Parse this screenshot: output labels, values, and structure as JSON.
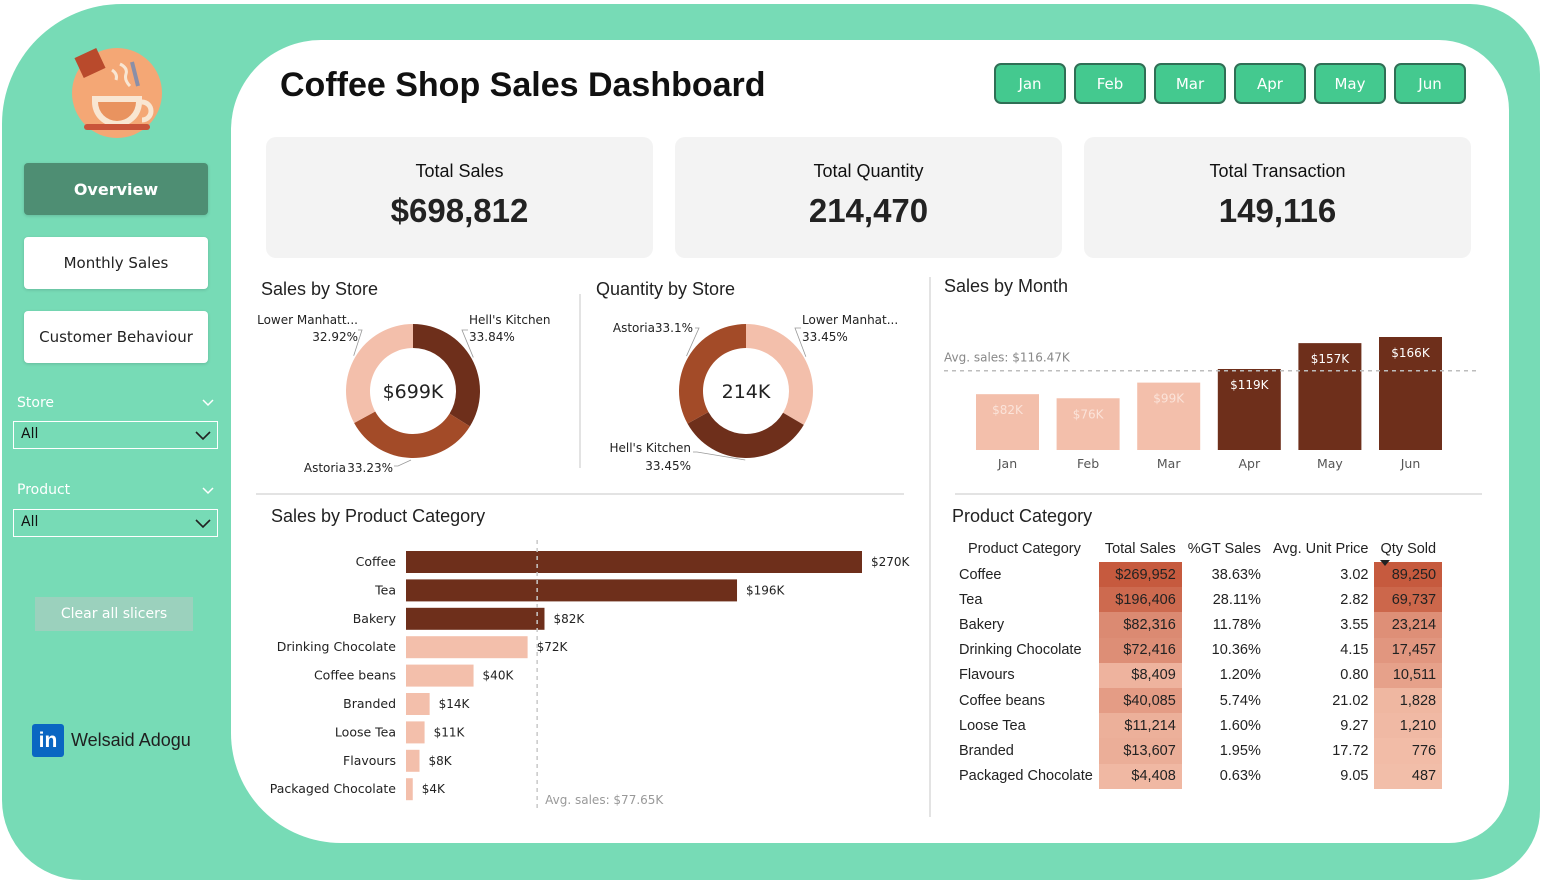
{
  "sidebar": {
    "nav": [
      "Overview",
      "Monthly Sales",
      "Customer Behaviour"
    ],
    "store_label": "Store",
    "store_value": "All",
    "product_label": "Product",
    "product_value": "All",
    "clear_label": "Clear all slicers",
    "author": "Welsaid Adogu",
    "author_icon": "linkedin-icon",
    "logo_icon": "coffee-cup-icon"
  },
  "header": {
    "title": "Coffee Shop Sales Dashboard",
    "months": [
      "Jan",
      "Feb",
      "Mar",
      "Apr",
      "May",
      "Jun"
    ]
  },
  "kpis": [
    {
      "label": "Total Sales",
      "value": "$698,812"
    },
    {
      "label": "Total Quantity",
      "value": "214,470"
    },
    {
      "label": "Total Transaction",
      "value": "149,116"
    }
  ],
  "colors": {
    "frame": "#77dbb6",
    "dark": "#6e2f1b",
    "mid": "#a34b28",
    "light": "#f3bfab",
    "month_button": "#44c98f"
  },
  "chart_data": [
    {
      "type": "pie",
      "title": "Sales by Store",
      "center_label": "$699K",
      "slices": [
        {
          "label": "Hell's Kitchen",
          "value": 33.84,
          "text": "33.84%"
        },
        {
          "label": "Astoria",
          "value": 33.23,
          "text": "33.23%"
        },
        {
          "label": "Lower Manhatt...",
          "value": 32.92,
          "text": "32.92%"
        }
      ]
    },
    {
      "type": "pie",
      "title": "Quantity by Store",
      "center_label": "214K",
      "slices": [
        {
          "label": "Lower Manhat...",
          "value": 33.45,
          "text": "33.45%"
        },
        {
          "label": "Hell's Kitchen",
          "value": 33.45,
          "text": "33.45%"
        },
        {
          "label": "Astoria",
          "value": 33.1,
          "text": "33.1%"
        }
      ]
    },
    {
      "type": "bar",
      "title": "Sales by Month",
      "categories": [
        "Jan",
        "Feb",
        "Mar",
        "Apr",
        "May",
        "Jun"
      ],
      "values": [
        82,
        76,
        99,
        119,
        157,
        166
      ],
      "labels": [
        "$82K",
        "$76K",
        "$99K",
        "$119K",
        "$157K",
        "$166K"
      ],
      "highlight": [
        false,
        false,
        false,
        true,
        true,
        true
      ],
      "average": 116.47,
      "average_label": "Avg. sales: $116.47K",
      "ylim": [
        0,
        166
      ]
    },
    {
      "type": "bar",
      "orientation": "horizontal",
      "title": "Sales by Product Category",
      "categories": [
        "Coffee",
        "Tea",
        "Bakery",
        "Drinking Chocolate",
        "Coffee beans",
        "Branded",
        "Loose Tea",
        "Flavours",
        "Packaged Chocolate"
      ],
      "values": [
        270,
        196,
        82,
        72,
        40,
        14,
        11,
        8,
        4
      ],
      "labels": [
        "$270K",
        "$196K",
        "$82K",
        "$72K",
        "$40K",
        "$14K",
        "$11K",
        "$8K",
        "$4K"
      ],
      "highlight": [
        true,
        true,
        true,
        false,
        false,
        false,
        false,
        false,
        false
      ],
      "average": 77.65,
      "average_label": "Avg. sales: $77.65K",
      "xlim": [
        0,
        270
      ]
    },
    {
      "type": "table",
      "title": "Product Category",
      "columns": [
        "Product Category",
        "Total Sales",
        "%GT Sales",
        "Avg. Unit Price",
        "Qty Sold"
      ],
      "rows": [
        {
          "category": "Coffee",
          "sales": "$269,952",
          "pct": "38.63%",
          "price": "3.02",
          "qty": "89,250",
          "sales_num": 269952,
          "qty_num": 89250
        },
        {
          "category": "Tea",
          "sales": "$196,406",
          "pct": "28.11%",
          "price": "2.82",
          "qty": "69,737",
          "sales_num": 196406,
          "qty_num": 69737
        },
        {
          "category": "Bakery",
          "sales": "$82,316",
          "pct": "11.78%",
          "price": "3.55",
          "qty": "23,214",
          "sales_num": 82316,
          "qty_num": 23214
        },
        {
          "category": "Drinking Chocolate",
          "sales": "$72,416",
          "pct": "10.36%",
          "price": "4.15",
          "qty": "17,457",
          "sales_num": 72416,
          "qty_num": 17457
        },
        {
          "category": "Flavours",
          "sales": "$8,409",
          "pct": "1.20%",
          "price": "0.80",
          "qty": "10,511",
          "sales_num": 8409,
          "qty_num": 10511
        },
        {
          "category": "Coffee beans",
          "sales": "$40,085",
          "pct": "5.74%",
          "price": "21.02",
          "qty": "1,828",
          "sales_num": 40085,
          "qty_num": 1828
        },
        {
          "category": "Loose Tea",
          "sales": "$11,214",
          "pct": "1.60%",
          "price": "9.27",
          "qty": "1,210",
          "sales_num": 11214,
          "qty_num": 1210
        },
        {
          "category": "Branded",
          "sales": "$13,607",
          "pct": "1.95%",
          "price": "17.72",
          "qty": "776",
          "sales_num": 13607,
          "qty_num": 776
        },
        {
          "category": "Packaged Chocolate",
          "sales": "$4,408",
          "pct": "0.63%",
          "price": "9.05",
          "qty": "487",
          "sales_num": 4408,
          "qty_num": 487
        }
      ]
    }
  ]
}
